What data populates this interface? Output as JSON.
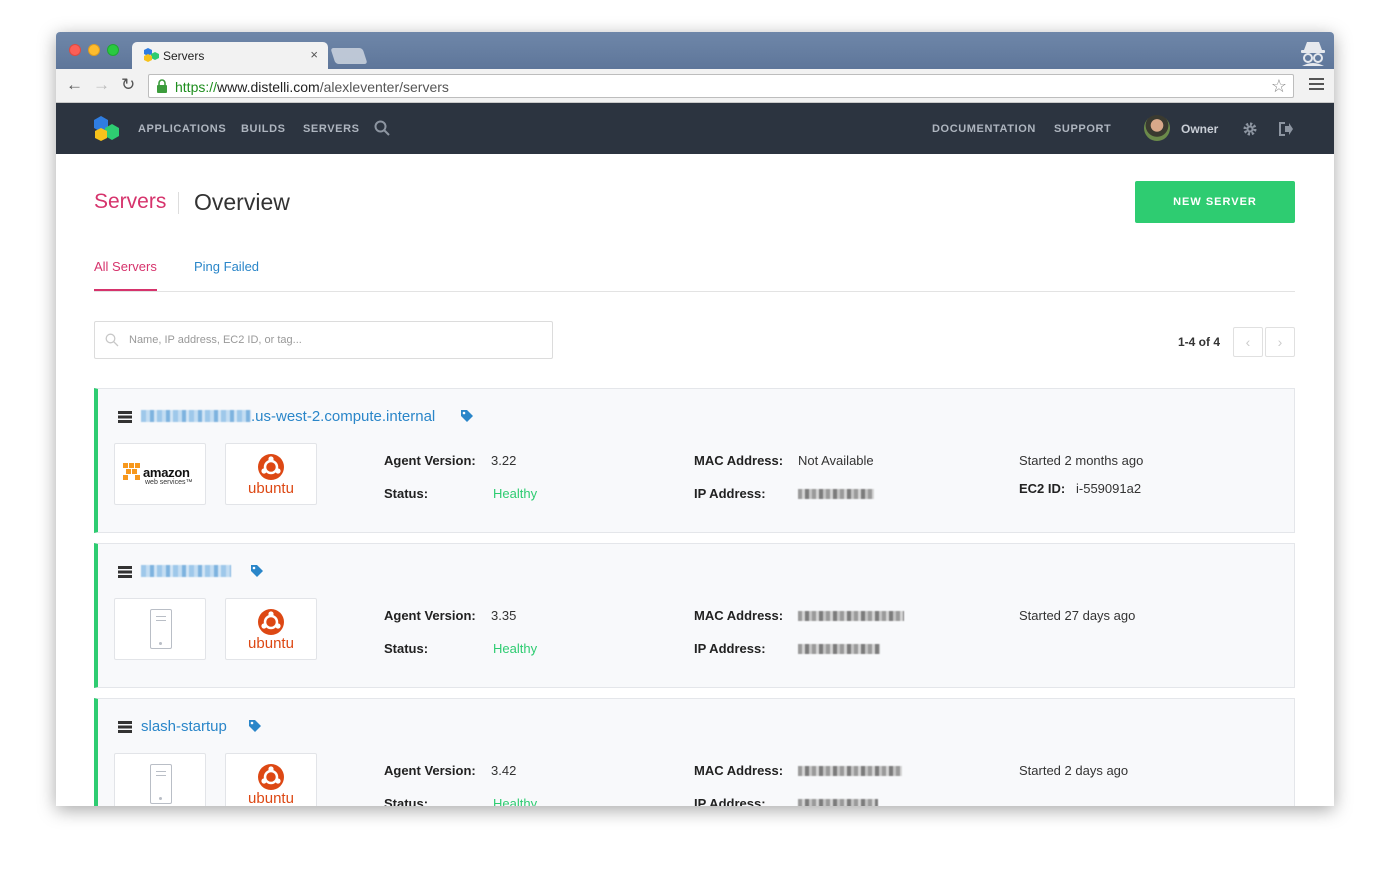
{
  "browser": {
    "tab_title": "Servers",
    "tab_close": "×",
    "url_scheme": "https://",
    "url_host": "www.distelli.com",
    "url_path": "/alexleventer/servers",
    "back_glyph": "←",
    "forward_glyph": "→",
    "reload_glyph": "↻",
    "star_glyph": "☆"
  },
  "nav": {
    "links": [
      "APPLICATIONS",
      "BUILDS",
      "SERVERS"
    ],
    "right_links": [
      "DOCUMENTATION",
      "SUPPORT"
    ],
    "user_role": "Owner"
  },
  "header": {
    "breadcrumb_parent": "Servers",
    "title": "Overview",
    "new_server_label": "NEW SERVER"
  },
  "tabs": [
    {
      "label": "All Servers",
      "active": true
    },
    {
      "label": "Ping Failed",
      "active": false
    }
  ],
  "search": {
    "placeholder": "Name, IP address, EC2 ID, or tag..."
  },
  "pagination": {
    "range_text": "1-4 of 4",
    "prev_glyph": "‹",
    "next_glyph": "›"
  },
  "labels": {
    "agent_version": "Agent Version:",
    "status": "Status:",
    "mac_address": "MAC Address:",
    "ip_address": "IP Address:",
    "ec2_id": "EC2 ID:"
  },
  "servers": [
    {
      "name_visible": ".us-west-2.compute.internal",
      "provider": "amazon",
      "provider_word": "amazon",
      "provider_sub": "web services™",
      "os": "ubuntu",
      "agent_version": "3.22",
      "status": "Healthy",
      "mac_address": "Not Available",
      "started": "Started 2 months ago",
      "ec2_id": "i-559091a2"
    },
    {
      "name_visible": "",
      "provider": "generic",
      "os": "ubuntu",
      "agent_version": "3.35",
      "status": "Healthy",
      "mac_address": "",
      "started": "Started 27 days ago"
    },
    {
      "name_visible": "slash-startup",
      "provider": "generic",
      "os": "ubuntu",
      "agent_version": "3.42",
      "status": "Healthy",
      "mac_address": "",
      "started": "Started 2 days ago"
    }
  ],
  "colors": {
    "accent_pink": "#d6336c",
    "link_blue": "#2a86c9",
    "success_green": "#2ecc71",
    "nav_bg": "#2c3440",
    "ubuntu_orange": "#dd4814"
  },
  "icons": [
    "search-icon",
    "gear-icon",
    "logout-icon",
    "tag-icon",
    "server-icon",
    "lock-icon",
    "star-icon",
    "menu-icon",
    "incognito-icon"
  ]
}
